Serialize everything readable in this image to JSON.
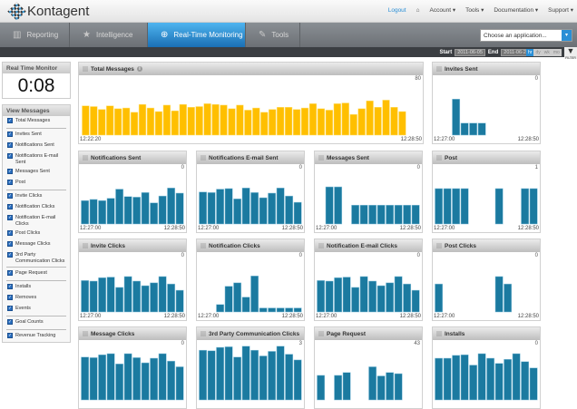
{
  "brand": "Kontagent",
  "top_links": {
    "logout": "Logout",
    "home_icon": "home-icon",
    "account": "Account ▾",
    "tools": "Tools ▾",
    "documentation": "Documentation ▾",
    "support": "Support ▾"
  },
  "nav": {
    "tabs": [
      {
        "label": "Reporting",
        "icon": "bar-chart-icon",
        "active": false
      },
      {
        "label": "Intelligence",
        "icon": "star-icon",
        "active": false
      },
      {
        "label": "Real-Time Monitoring",
        "icon": "magnifier-icon",
        "active": true
      },
      {
        "label": "Tools",
        "icon": "wrench-icon",
        "active": false
      }
    ],
    "app_select": {
      "value": "Choose an application..."
    }
  },
  "range": {
    "start_label": "Start",
    "start": "2011-06-05",
    "end_label": "End",
    "end": "2011-06-23",
    "scales": [
      "hr",
      "dy",
      "wk",
      "mo"
    ],
    "active_scale": "hr",
    "filter": "FILTER"
  },
  "monitor": {
    "title": "Real Time Monitor",
    "time": "0:08"
  },
  "view_messages": {
    "title": "View Messages",
    "groups": [
      [
        "Total Messages"
      ],
      [
        "Invites Sent",
        "Notifications Sent",
        "Notifications E-mail Sent",
        "Messages Sent",
        "Post"
      ],
      [
        "Invite Clicks",
        "Notification Clicks",
        "Notification E-mail Clicks",
        "Post Clicks",
        "Message Clicks",
        "3rd Party Communication Clicks"
      ],
      [
        "Page Request"
      ],
      [
        "Installs",
        "Removes",
        "Events"
      ],
      [
        "Goal Counts"
      ],
      [
        "Revenue Tracking"
      ]
    ]
  },
  "colors": {
    "accent_bar": "#ffbf00",
    "series_bar": "#1b7aa0",
    "active_tab": "#2a8fd6"
  },
  "chart_data": [
    {
      "type": "bar",
      "title": "Total Messages",
      "ymax_label": "80",
      "ylim": [
        0,
        80
      ],
      "x_start": "12:22:20",
      "x_end": "12:28:50",
      "color": "#ffbf00",
      "values": [
        41,
        40,
        36,
        41,
        37,
        38,
        32,
        43,
        38,
        33,
        42,
        34,
        43,
        39,
        40,
        44,
        43,
        42,
        37,
        42,
        35,
        38,
        32,
        36,
        39,
        39,
        36,
        38,
        44,
        37,
        35,
        44,
        45,
        29,
        37,
        48,
        39,
        49,
        39,
        33
      ]
    },
    {
      "type": "bar",
      "title": "Invites Sent",
      "ymax_label": "0",
      "x_start": "12:27:00",
      "x_end": "12:28:50",
      "values": [
        0,
        0,
        0.63,
        0.21,
        0.21,
        0.21,
        0,
        0,
        0,
        0,
        0,
        0
      ]
    },
    {
      "type": "bar",
      "title": "Notifications Sent",
      "ymax_label": "0",
      "x_start": "12:27:00",
      "x_end": "12:28:50",
      "values": [
        0.41,
        0.43,
        0.41,
        0.45,
        0.61,
        0.48,
        0.47,
        0.55,
        0.37,
        0.49,
        0.63,
        0.54
      ]
    },
    {
      "type": "bar",
      "title": "Notifications E-mail Sent",
      "ymax_label": "0",
      "x_start": "12:27:00",
      "x_end": "12:28:50",
      "values": [
        0.56,
        0.55,
        0.61,
        0.62,
        0.44,
        0.63,
        0.55,
        0.46,
        0.54,
        0.63,
        0.49,
        0.38
      ]
    },
    {
      "type": "bar",
      "title": "Messages Sent",
      "ymax_label": "0",
      "x_start": "12:27:00",
      "x_end": "12:28:50",
      "values": [
        0,
        0.65,
        0.65,
        0,
        0.33,
        0.33,
        0.33,
        0.33,
        0.33,
        0.33,
        0.33,
        0.33
      ]
    },
    {
      "type": "bar",
      "title": "Post",
      "ymax_label": "1",
      "x_start": "12:27:00",
      "x_end": "12:28:50",
      "values": [
        0.62,
        0.62,
        0.62,
        0.62,
        0,
        0,
        0,
        0.62,
        0,
        0,
        0.62,
        0.62
      ]
    },
    {
      "type": "bar",
      "title": "Invite Clicks",
      "ymax_label": "0",
      "x_start": "12:27:00",
      "x_end": "12:28:50",
      "values": [
        0.55,
        0.54,
        0.6,
        0.61,
        0.43,
        0.62,
        0.54,
        0.46,
        0.51,
        0.62,
        0.49,
        0.38
      ]
    },
    {
      "type": "bar",
      "title": "Notification Clicks",
      "ymax_label": "0",
      "x_start": "12:27:00",
      "x_end": "12:28:50",
      "values": [
        0,
        0,
        0.13,
        0.45,
        0.51,
        0.26,
        0.63,
        0.07,
        0.07,
        0.07,
        0.07,
        0.07
      ]
    },
    {
      "type": "bar",
      "title": "Notification E-mail Clicks",
      "ymax_label": "0",
      "x_start": "12:27:00",
      "x_end": "12:28:50",
      "values": [
        0.55,
        0.54,
        0.6,
        0.61,
        0.43,
        0.62,
        0.54,
        0.46,
        0.51,
        0.62,
        0.49,
        0.38
      ]
    },
    {
      "type": "bar",
      "title": "Post Clicks",
      "ymax_label": "0",
      "x_start": "12:27:00",
      "x_end": "12:28:50",
      "values": [
        0.49,
        0,
        0,
        0,
        0,
        0,
        0,
        0.62,
        0.49,
        0,
        0,
        0
      ]
    },
    {
      "type": "bar",
      "title": "Message Clicks",
      "ymax_label": "0",
      "values": [
        0.75,
        0.74,
        0.79,
        0.81,
        0.63,
        0.81,
        0.74,
        0.65,
        0.73,
        0.81,
        0.68,
        0.58
      ]
    },
    {
      "type": "bar",
      "title": "3rd Party Communication Clicks",
      "ymax_label": "3",
      "values": [
        0.87,
        0.86,
        0.92,
        0.93,
        0.75,
        0.94,
        0.87,
        0.77,
        0.85,
        0.94,
        0.8,
        0.7
      ]
    },
    {
      "type": "bar",
      "title": "Page Request",
      "ymax_label": "43",
      "values": [
        0.43,
        0,
        0.43,
        0.48,
        0,
        0,
        0.58,
        0.42,
        0.48,
        0.46,
        0,
        0
      ]
    },
    {
      "type": "bar",
      "title": "Installs",
      "ymax_label": "0",
      "values": [
        0.73,
        0.73,
        0.78,
        0.79,
        0.61,
        0.81,
        0.73,
        0.64,
        0.71,
        0.81,
        0.67,
        0.56
      ]
    }
  ]
}
